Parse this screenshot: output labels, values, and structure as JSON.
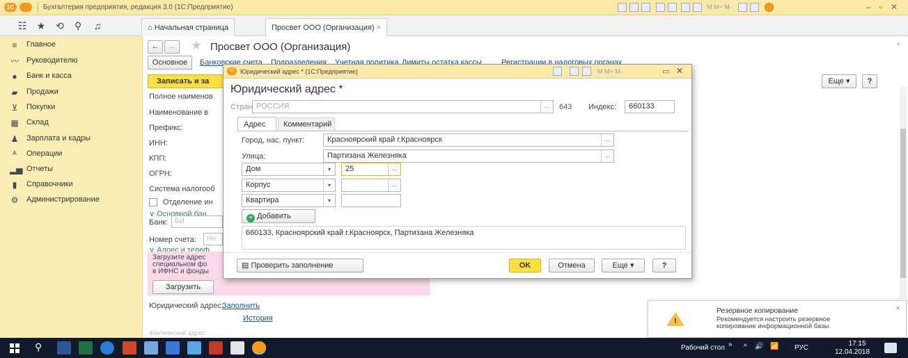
{
  "titlebar": {
    "text": "Бухгалтерия предприятия, редакция 3.0  (1С:Предприятие)",
    "logo": "1С",
    "window_buttons": [
      "–",
      "▫",
      "✕"
    ]
  },
  "tabs": [
    {
      "label": "Начальная страница"
    },
    {
      "label": "Просвет ООО (Организация)",
      "close": "×"
    }
  ],
  "sidebar": {
    "items": [
      {
        "label": "Главное",
        "icon": "menu-icon"
      },
      {
        "label": "Руководителю",
        "icon": "chart-line-icon"
      },
      {
        "label": "Банк и касса",
        "icon": "coins-icon"
      },
      {
        "label": "Продажи",
        "icon": "shop-icon"
      },
      {
        "label": "Покупки",
        "icon": "cart-icon"
      },
      {
        "label": "Склад",
        "icon": "warehouse-icon"
      },
      {
        "label": "Зарплата и кадры",
        "icon": "person-icon"
      },
      {
        "label": "Операции",
        "icon": "operations-icon"
      },
      {
        "label": "Отчеты",
        "icon": "bar-chart-icon"
      },
      {
        "label": "Справочники",
        "icon": "book-icon"
      },
      {
        "label": "Администрирование",
        "icon": "gear-icon"
      }
    ]
  },
  "main": {
    "title": "Просвет ООО (Организация)",
    "nav_tabs": [
      "Основное",
      "Банковские счета",
      "Подразделения",
      "Учетная политика",
      "Лимиты остатка кассы",
      "Регистрации в налоговых органах"
    ],
    "save_button": "Записать и за",
    "more_button": "Еще",
    "help_button": "?",
    "fields": [
      "Полное наименов",
      "Наименование в",
      "Префикс:",
      "ИНН:",
      "КПП:",
      "ОГРН:",
      "Система налогооб"
    ],
    "checkbox_label": "Отделение ин",
    "section_bank": "Основной бан",
    "bank_label": "Банк:",
    "bank_value": "БИ",
    "account_label": "Номер счета:",
    "account_value": "Но",
    "section_address": "Адрес и телеф",
    "pink_text": [
      "Загрузите адрес",
      "специальном фо",
      "в ИФНС и фонды"
    ],
    "load_button": "Загрузить",
    "legal_address_label": "Юридический адрес:",
    "fill_link": "Заполнить",
    "history_link": "История",
    "actual_address_label": "Фактический адрес:"
  },
  "dialog": {
    "window_title": "Юридический адрес * (1С:Предприятие)",
    "heading": "Юридический адрес *",
    "country_label": "Страна:",
    "country_value": "РОССИЯ",
    "country_code": "643",
    "index_label": "Индекс:",
    "index_value": "660133",
    "tabs": [
      "Адрес",
      "Комментарий"
    ],
    "city_label": "Город, нас. пункт:",
    "city_value": "Красноярский край г.Красноярск",
    "street_label": "Улица:",
    "street_value": "Партизана Железняка",
    "house_type": "Дом",
    "house_value": "25",
    "building_type": "Корпус",
    "building_value": "",
    "apartment_type": "Квартира",
    "apartment_value": "",
    "add_button": "Добавить",
    "full_address": "660133, Красноярский край г.Красноярск, Партизана Железняка",
    "check_button": "Проверить заполнение",
    "ok_button": "OK",
    "cancel_button": "Отмена",
    "more_button": "Еще",
    "help_button": "?",
    "dots": "..."
  },
  "notification": {
    "title": "Резервное копирование",
    "text1": "Рекомендуется настроить резервное",
    "text2": "копирование информационной базы.",
    "close": "×"
  },
  "taskbar": {
    "desktop_label": "Рабочий стол",
    "lang": "РУС",
    "time": "17:15",
    "date": "12.04.2018",
    "chevron": "»",
    "up": "^",
    "volume": "🔊",
    "network": "📶"
  }
}
